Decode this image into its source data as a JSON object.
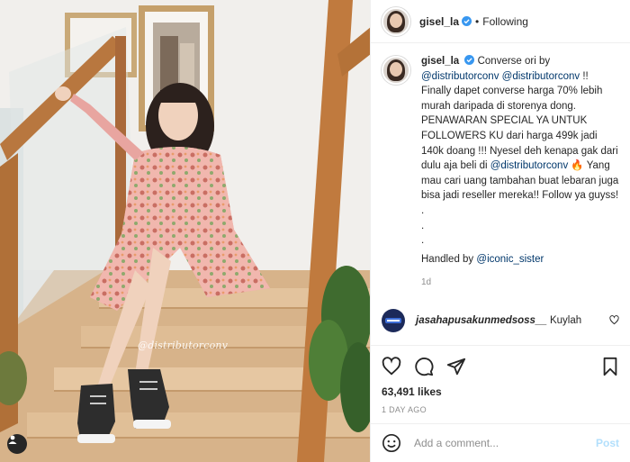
{
  "photo": {
    "watermark": "@distributorconv",
    "alt": "woman in floral dress sitting on stairs"
  },
  "header": {
    "username": "gisel_la",
    "separator": "•",
    "follow_status": "Following"
  },
  "caption": {
    "username": "gisel_la",
    "text_1": "Converse ori by",
    "mention_1": "@distributorconv",
    "mention_2": "@distributorconv",
    "text_2": "!! Finally dapet converse harga 70% lebih murah daripada di storenya dong. PENAWARAN SPECIAL YA UNTUK FOLLOWERS KU dari harga 499k jadi 140k doang !!! Nyesel deh kenapa gak dari dulu aja beli di",
    "mention_3": "@distributorconv",
    "text_3": "🔥 Yang mau cari uang tambahan buat lebaran juga bisa jadi reseller mereka!! Follow ya guyss!",
    "dots": [
      ".",
      ".",
      "."
    ],
    "handled_prefix": "Handled by",
    "handled_mention": "@iconic_sister",
    "time": "1d"
  },
  "reply": {
    "username": "jasahapusakunmedsoss__",
    "text": "Kuylah"
  },
  "actions": {
    "likes": "63,491 likes",
    "posted": "1 DAY AGO"
  },
  "comment_box": {
    "placeholder": "Add a comment...",
    "post_label": "Post"
  },
  "colors": {
    "link": "#00376b",
    "verified": "#3897f0",
    "post_disabled": "#b2dffc"
  }
}
